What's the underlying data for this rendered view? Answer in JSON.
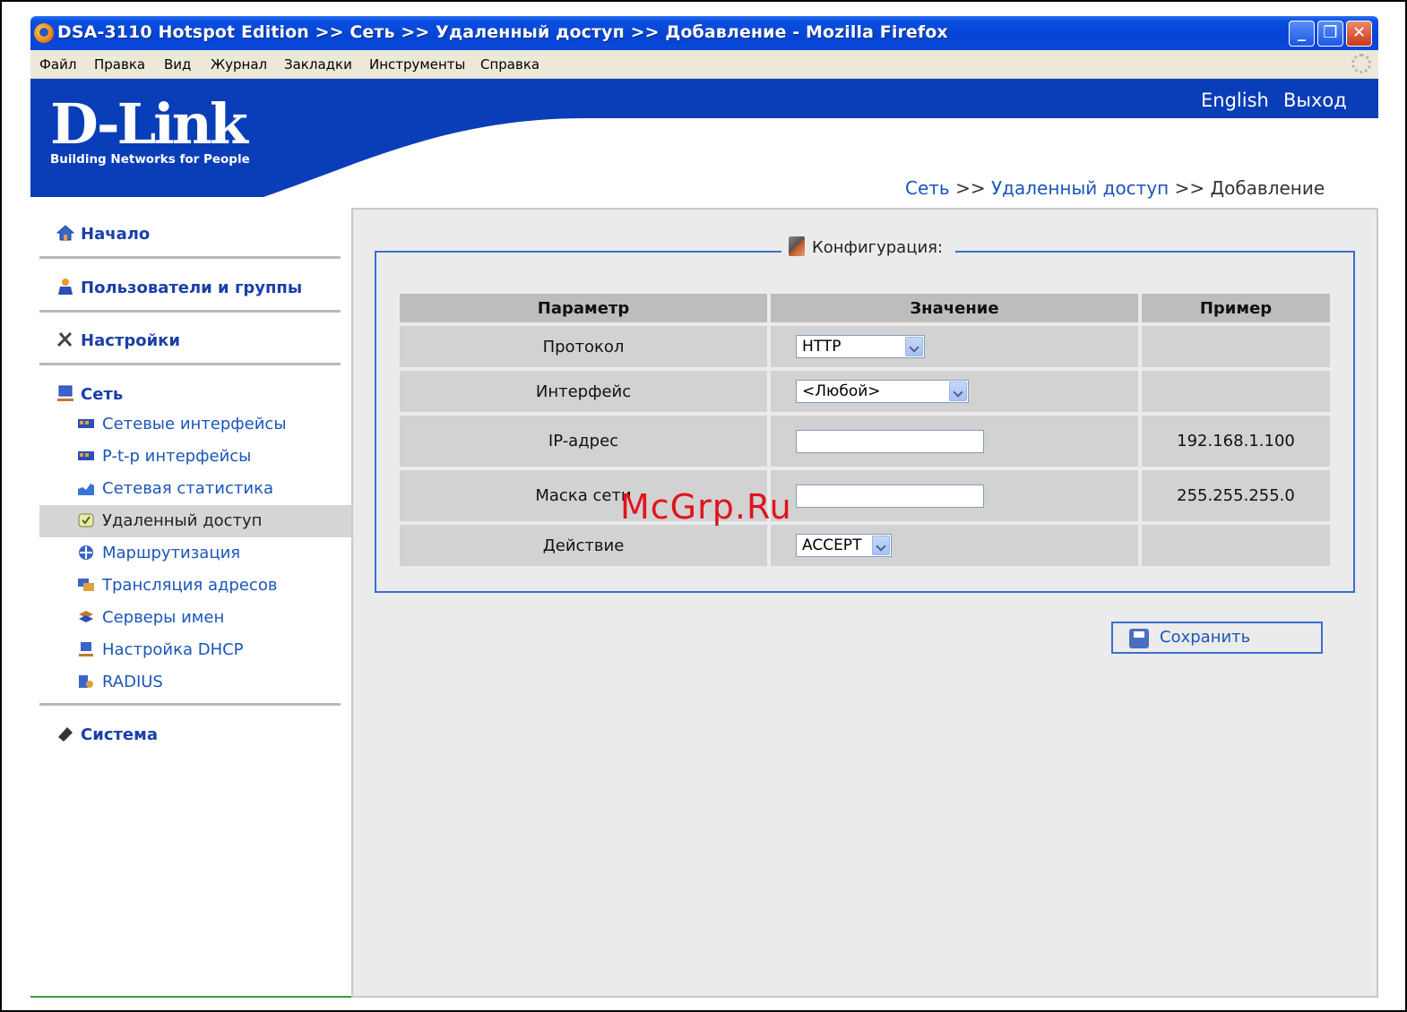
{
  "window": {
    "title": "DSA-3110 Hotspot Edition >> Сеть >> Удаленный доступ >> Добавление - Mozilla Firefox",
    "buttons": {
      "minimize": "_",
      "maximize": "❐",
      "close": "✕"
    }
  },
  "menu": {
    "items": [
      "Файл",
      "Правка",
      "Вид",
      "Журнал",
      "Закладки",
      "Инструменты",
      "Справка"
    ]
  },
  "header": {
    "logo": "D-Link",
    "tagline": "Building Networks for People",
    "lang_link": "English",
    "logout_link": "Выход",
    "brand_color": "#0a3db8"
  },
  "breadcrumb": {
    "network": "Сеть",
    "sep1": " >> ",
    "remote": "Удаленный доступ",
    "sep2": " >> ",
    "current": "Добавление"
  },
  "sidebar": {
    "home": "Начало",
    "users": "Пользователи и группы",
    "settings": "Настройки",
    "network": "Сеть",
    "sub": [
      "Сетевые интерфейсы",
      "P-t-p интерфейсы",
      "Сетевая статистика",
      "Удаленный доступ",
      "Маршрутизация",
      "Трансляция адресов",
      "Серверы имен",
      "Настройка DHCP",
      "RADIUS"
    ],
    "active_index": 3,
    "system": "Система"
  },
  "config": {
    "legend": "Конфигурация:",
    "columns": [
      "Параметр",
      "Значение",
      "Пример"
    ],
    "rows": [
      {
        "param": "Протокол",
        "type": "select",
        "value": "HTTP",
        "example": ""
      },
      {
        "param": "Интерфейс",
        "type": "select",
        "value": "<Любой>",
        "example": ""
      },
      {
        "param": "IP-адрес",
        "type": "input",
        "value": "",
        "example": "192.168.1.100"
      },
      {
        "param": "Маска сети",
        "type": "input",
        "value": "",
        "example": "255.255.255.0"
      },
      {
        "param": "Действие",
        "type": "select",
        "value": "ACCEPT",
        "example": ""
      }
    ],
    "save_label": "Сохранить"
  },
  "watermark": "McGrp.Ru"
}
